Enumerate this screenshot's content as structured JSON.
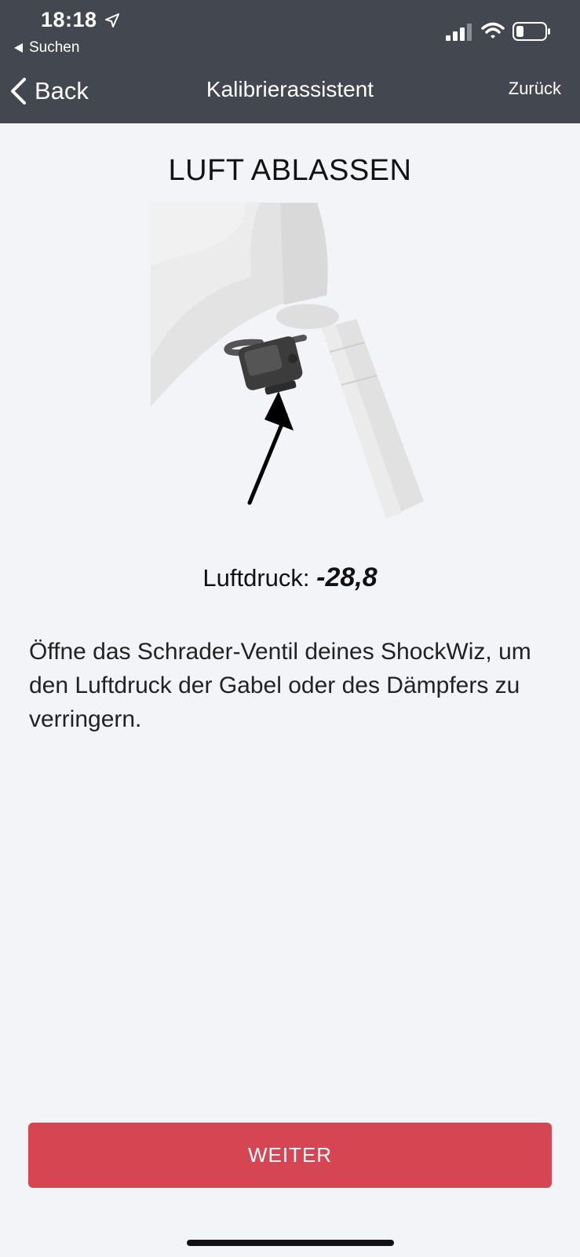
{
  "status_bar": {
    "time": "18:18",
    "back_app": "Suchen",
    "icons": [
      "location-arrow-icon",
      "cellular-signal-icon",
      "wifi-icon",
      "battery-icon"
    ]
  },
  "nav": {
    "back_label": "Back",
    "title": "Kalibrierassistent",
    "right_label": "Zurück"
  },
  "step": {
    "title": "LUFT ABLASSEN",
    "pressure_label": "Luftdruck:",
    "pressure_value": "-28,8",
    "instruction": "Öffne das Schrader-Ventil deines ShockWiz, um den Luftdruck der Gabel oder des Dämpfers zu verringern."
  },
  "actions": {
    "next_label": "WEITER"
  },
  "colors": {
    "header_bg": "#434850",
    "page_bg": "#f3f4f8",
    "button_bg": "#d64552",
    "button_text": "#ffffff"
  }
}
